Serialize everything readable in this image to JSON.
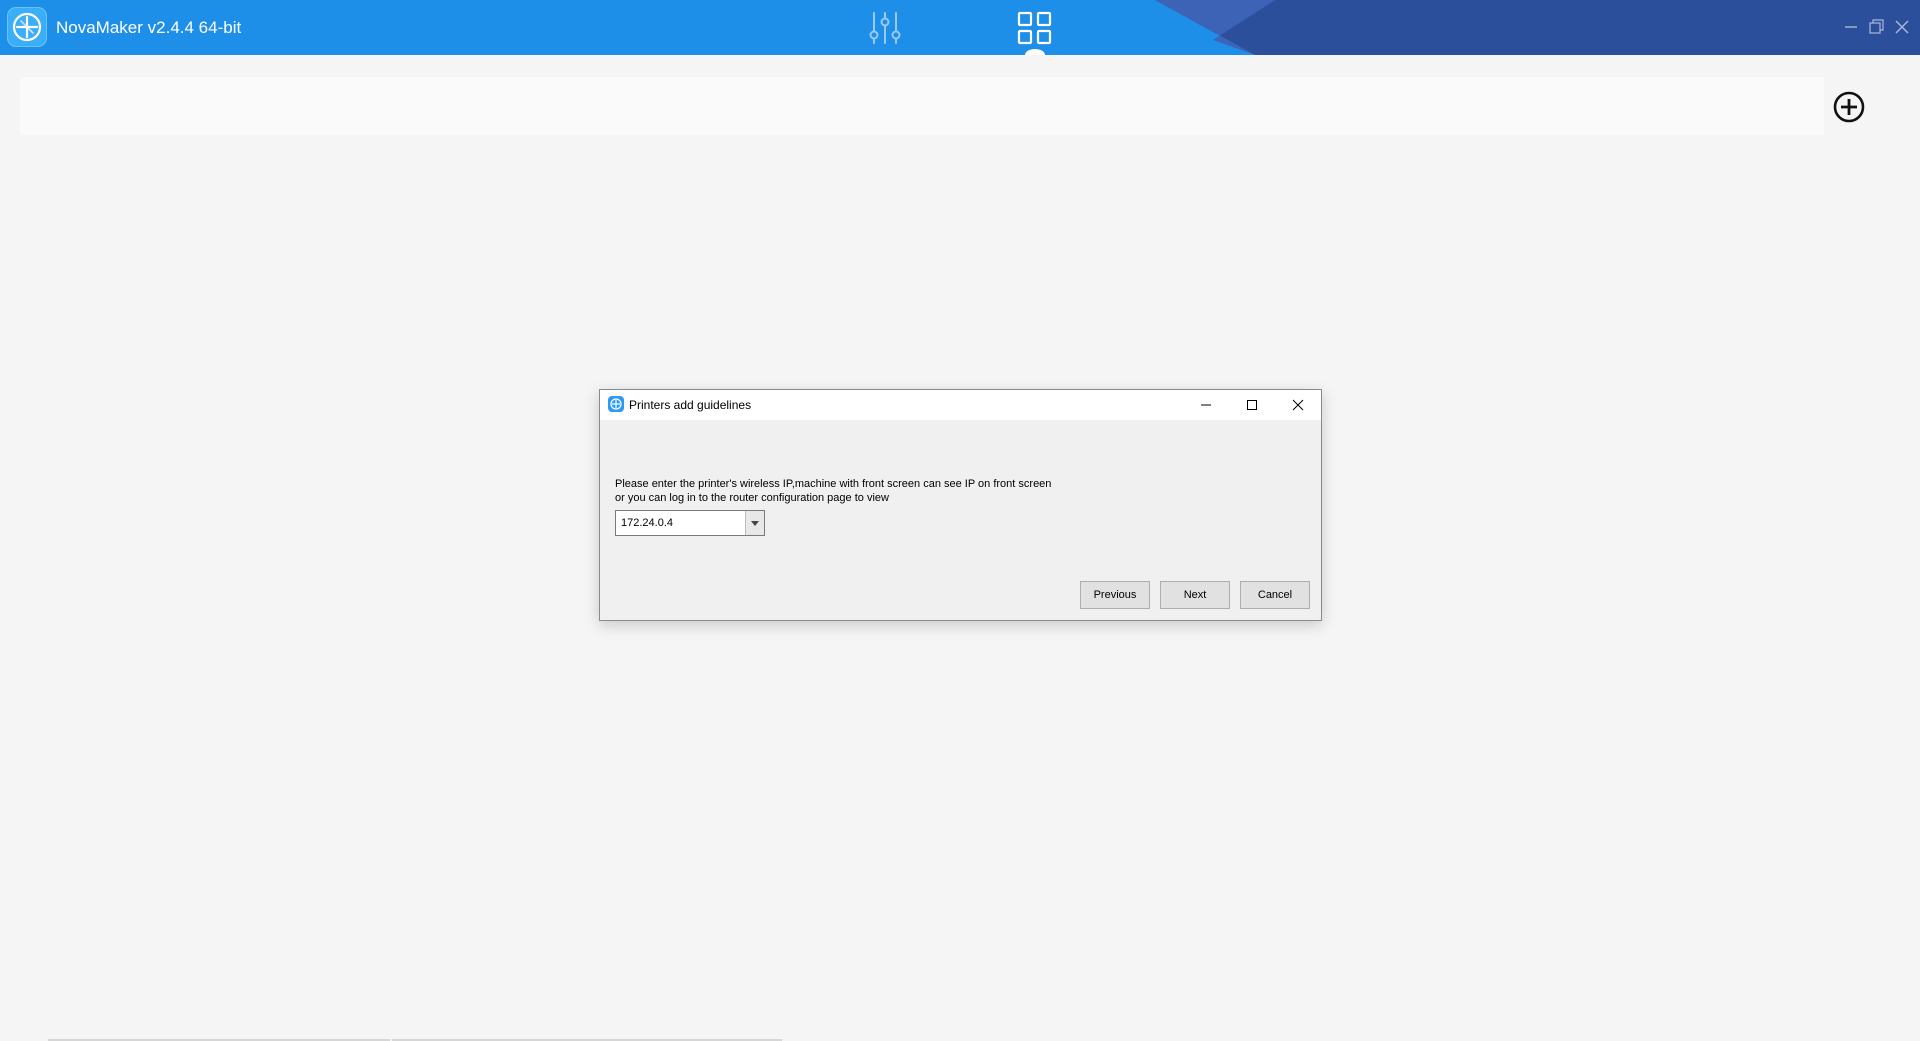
{
  "app": {
    "title": "NovaMaker v2.4.4 64-bit",
    "nav": {
      "settings_icon": "sliders-icon",
      "devices_icon": "grid-icon",
      "active": "devices"
    }
  },
  "main": {
    "add_printer_icon": "plus-circle-icon"
  },
  "dialog": {
    "title": "Printers add guidelines",
    "instruction_line1": "Please enter the printer's wireless IP,machine with front screen can see IP on front screen",
    "instruction_line2": "or you can log in to the router configuration page to view",
    "ip_value": "172.24.0.4",
    "buttons": {
      "previous": "Previous",
      "next": "Next",
      "cancel": "Cancel"
    }
  },
  "colors": {
    "titlebar": "#1e8fe8",
    "titlebar_dark": "#2c4f9c",
    "background": "#f5f5f5"
  }
}
